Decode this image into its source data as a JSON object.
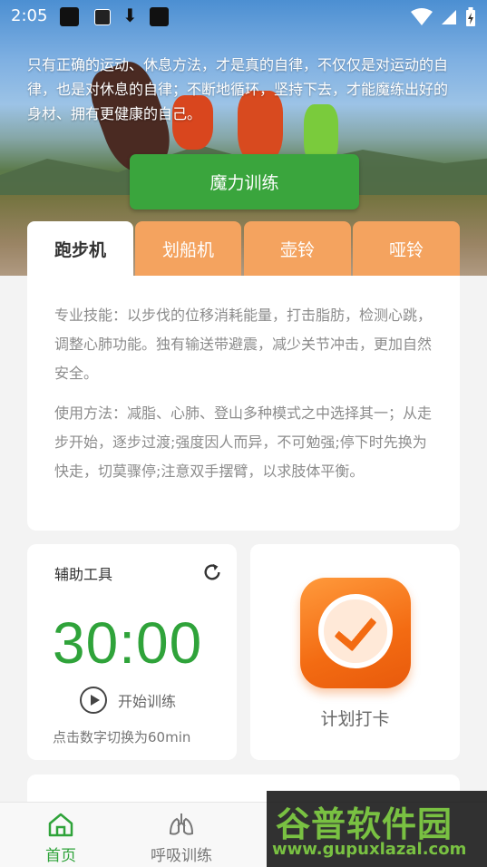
{
  "status_bar": {
    "time": "2:05"
  },
  "hero": {
    "motto": "只有正确的运动、休息方法，才是真的自律，不仅仅是对运动的自律，也是对休息的自律；不断地循环，坚持下去，才能魔练出好的身材、拥有更健康的自己。",
    "cta_label": "魔力训练"
  },
  "tabs": [
    {
      "label": "跑步机",
      "active": true
    },
    {
      "label": "划船机",
      "active": false
    },
    {
      "label": "壶铃",
      "active": false
    },
    {
      "label": "哑铃",
      "active": false
    }
  ],
  "equipment_info": {
    "skill": "专业技能：以步伐的位移消耗能量，打击脂肪，检测心跳，调整心肺功能。独有输送带避震，减少关节冲击，更加自然安全。",
    "usage": "使用方法：减脂、心肺、登山多种模式之中选择其一；从走步开始，逐步过渡;强度因人而异，不可勉强;停下时先换为快走，切莫骤停;注意双手摆臂，以求肢体平衡。"
  },
  "timer": {
    "title": "辅助工具",
    "time": "30:00",
    "start_label": "开始训练",
    "hint": "点击数字切换为60min"
  },
  "checkin": {
    "label": "计划打卡"
  },
  "bottom_nav": [
    {
      "label": "首页",
      "active": true,
      "icon": "home-icon"
    },
    {
      "label": "呼吸训练",
      "active": false,
      "icon": "lungs-icon"
    }
  ],
  "watermark": {
    "logo": "谷普软件园",
    "url": "www.gupuxlazal.com"
  },
  "colors": {
    "accent_green": "#2fa33a",
    "tab_orange": "#f4a35f",
    "checkin_orange": "#f36b12"
  }
}
